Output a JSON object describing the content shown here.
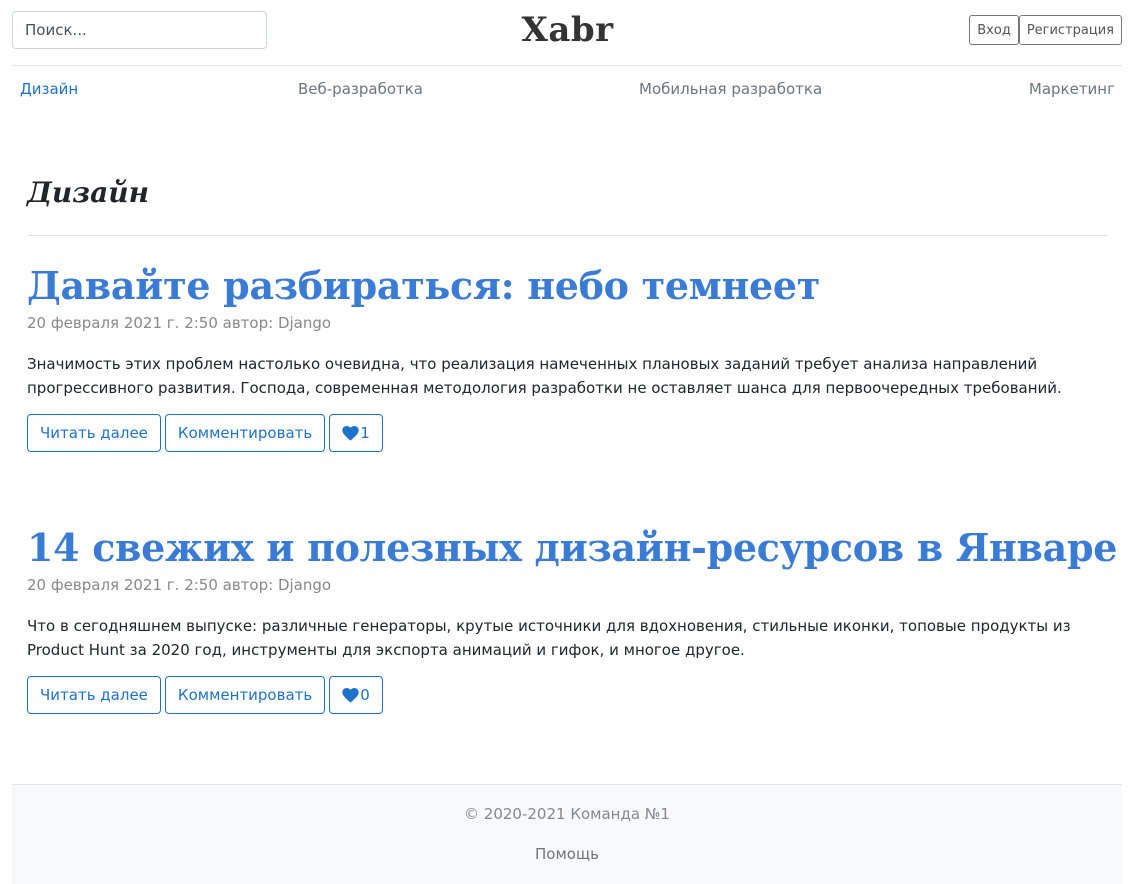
{
  "header": {
    "search_placeholder": "Поиск...",
    "brand": "Xabr",
    "login_label": "Вход",
    "register_label": "Регистрация"
  },
  "nav": {
    "items": [
      {
        "label": "Дизайн",
        "active": true
      },
      {
        "label": "Веб-разработка",
        "active": false
      },
      {
        "label": "Мобильная разработка",
        "active": false
      },
      {
        "label": "Маркетинг",
        "active": false
      }
    ]
  },
  "category": {
    "title": "Дизайн"
  },
  "posts": [
    {
      "title": "Давайте разбираться: небо темнеет",
      "meta": "20 февраля 2021 г. 2:50 автор: Django",
      "body": "Значимость этих проблем настолько очевидна, что реализация намеченных плановых заданий требует анализа направлений прогрессивного развития. Господа, современная методология разработки не оставляет шанса для первоочередных требований.",
      "read_more_label": "Читать далее",
      "comment_label": "Комментировать",
      "likes": "1"
    },
    {
      "title": "14 свежих и полезных дизайн-ресурсов в Январе",
      "meta": "20 февраля 2021 г. 2:50 автор: Django",
      "body": "Что в сегодняшнем выпуске: различные генераторы, крутые источники для вдохновения, стильные иконки, топовые продукты из Product Hunt за 2020 год, инструменты для экспорта анимаций и гифок, и многое другое.",
      "read_more_label": "Читать далее",
      "comment_label": "Комментировать",
      "likes": "0"
    }
  ],
  "footer": {
    "copyright": "© 2020-2021 Команда №1",
    "help_label": "Помощь"
  },
  "colors": {
    "accent": "#1f72cc",
    "title_blue": "#3a7bd5"
  }
}
